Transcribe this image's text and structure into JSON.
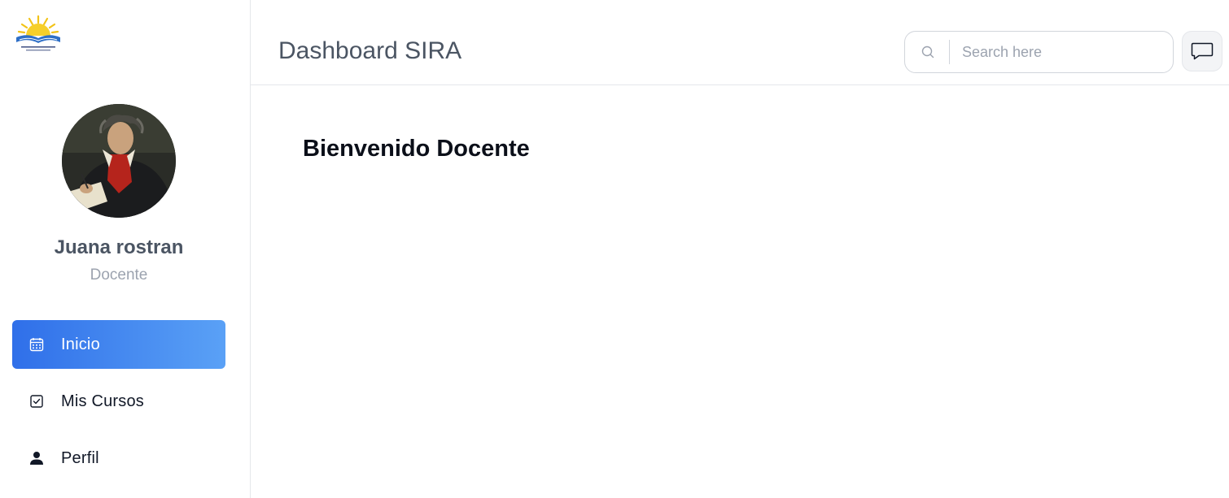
{
  "sidebar": {
    "logo_icon": "school-logo-icon",
    "user": {
      "name": "Juana rostran",
      "role": "Docente",
      "avatar_icon": "user-avatar-portrait"
    },
    "items": [
      {
        "label": "Inicio",
        "icon": "calendar-icon",
        "active": true
      },
      {
        "label": "Mis Cursos",
        "icon": "checkbox-icon",
        "active": false
      },
      {
        "label": "Perfil",
        "icon": "person-icon",
        "active": false
      }
    ]
  },
  "header": {
    "title": "Dashboard SIRA",
    "search": {
      "placeholder": "Search here",
      "value": "",
      "icon": "search-icon"
    },
    "chat_icon": "message-icon"
  },
  "main": {
    "welcome": "Bienvenido Docente"
  },
  "colors": {
    "accent_start": "#2f6fe9",
    "accent_end": "#5aa1f6",
    "title": "#4b5563",
    "muted": "#9ca3af"
  }
}
